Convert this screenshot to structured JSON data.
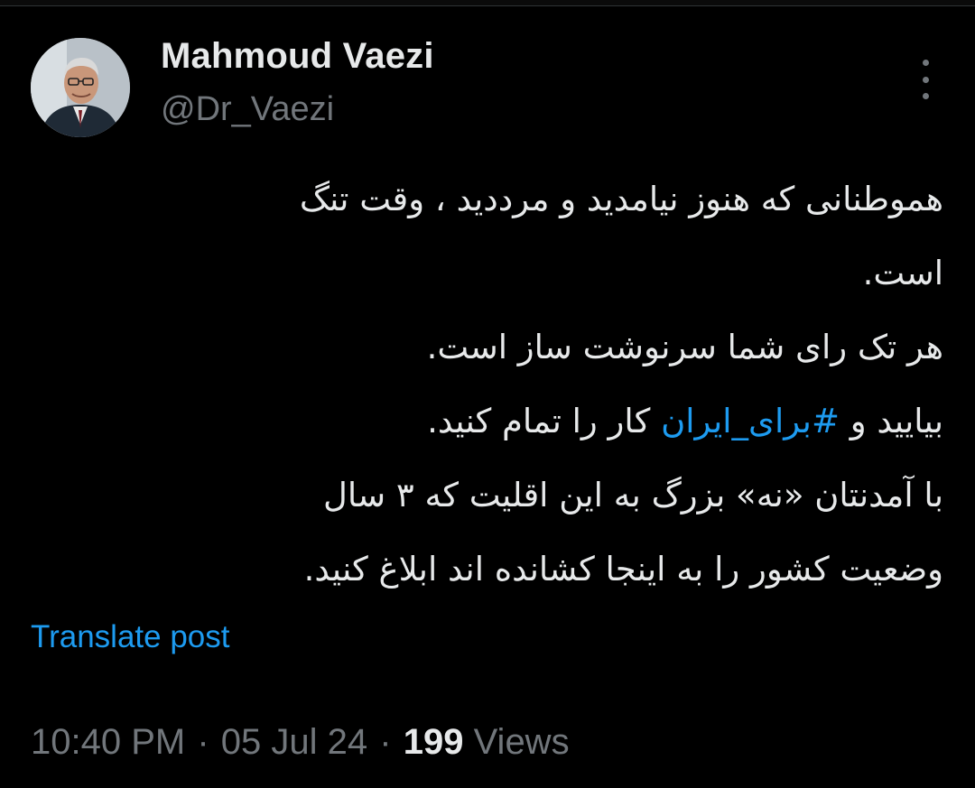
{
  "author": {
    "name": "Mahmoud Vaezi",
    "handle": "@Dr_Vaezi",
    "avatar_icon": "avatar-photo"
  },
  "menu": {
    "icon": "more-vertical-icon"
  },
  "post": {
    "lines": [
      {
        "text": "هموطنانی که هنوز نیامدید و مرددید ، وقت تنگ"
      },
      {
        "text": "است."
      },
      {
        "text": "هر تک رای شما سرنوشت ساز است."
      },
      {
        "before": "بیایید و ",
        "hashtag": "#برای_ایران",
        "after": " کار را تمام کنید."
      },
      {
        "text": "با آمدنتان «نه» بزرگ به این اقلیت که ۳ سال"
      },
      {
        "text": "وضعیت کشور را به اینجا کشانده اند ابلاغ کنید."
      }
    ]
  },
  "translate_label": "Translate post",
  "meta": {
    "time": "10:40 PM",
    "separator": "·",
    "date": "05 Jul 24",
    "views_count": "199",
    "views_label": "Views"
  },
  "colors": {
    "background": "#000000",
    "text": "#e7e9ea",
    "secondary": "#71767b",
    "accent": "#1d9bf0"
  }
}
